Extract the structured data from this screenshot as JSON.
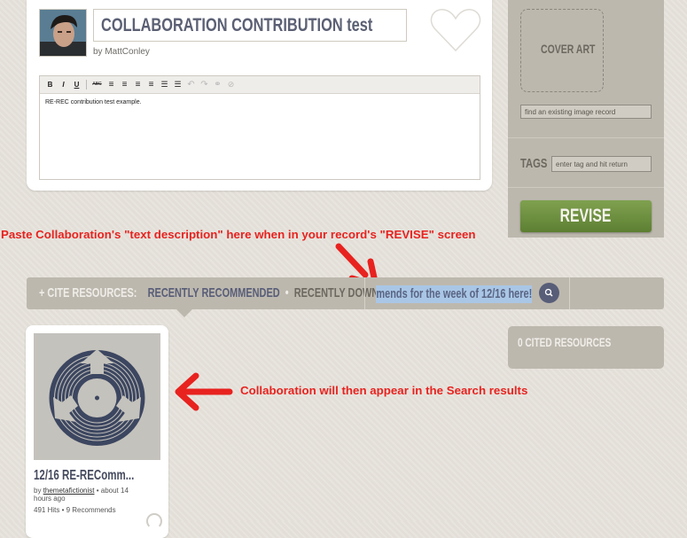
{
  "record": {
    "title": "COLLABORATION CONTRIBUTION test",
    "by_prefix": "by",
    "author": "MattConley",
    "editor_body": "RE-REC contribution test example."
  },
  "editor_toolbar": [
    {
      "label": "B",
      "icon": "bold-icon"
    },
    {
      "label": "I",
      "icon": "italic-icon"
    },
    {
      "label": "U",
      "icon": "underline-icon"
    },
    {
      "label": "ABC",
      "icon": "strikethrough-icon"
    },
    {
      "label": "≡",
      "icon": "align-left-icon"
    },
    {
      "label": "≡",
      "icon": "align-center-icon"
    },
    {
      "label": "≡",
      "icon": "align-right-icon"
    },
    {
      "label": "≡",
      "icon": "align-justify-icon"
    },
    {
      "label": "☰",
      "icon": "bullet-list-icon"
    },
    {
      "label": "☰",
      "icon": "numbered-list-icon"
    },
    {
      "label": "↶",
      "icon": "undo-icon"
    },
    {
      "label": "↷",
      "icon": "redo-icon"
    },
    {
      "label": "⚭",
      "icon": "link-icon"
    },
    {
      "label": "⊘",
      "icon": "unlink-icon"
    }
  ],
  "sidebar": {
    "cover_art_label": "COVER ART",
    "image_search_placeholder": "find an existing image record",
    "tags_label": "TAGS",
    "tags_placeholder": "enter tag and hit return",
    "revise_label": "REVISE"
  },
  "annotations": {
    "top": "Paste Collaboration's \"text description\" here when in your record's \"REVISE\" screen",
    "result": "Collaboration will then appear in the Search results"
  },
  "cite_bar": {
    "label": "+ CITE RESOURCES:",
    "recently_recommended": "RECENTLY RECOMMENDED",
    "separator": "•",
    "recently_downloaded": "RECENTLY DOWNLOADED",
    "search_value": "mmends for the week of 12/16 here!"
  },
  "cited_panel": {
    "label": "0 CITED RESOURCES"
  },
  "result": {
    "title": "12/16 RE-REComm...",
    "by_prefix": "by",
    "author": "themetafictionist",
    "time": " • about 14 hours ago",
    "stats": "491 Hits • 9 Recommends"
  },
  "colors": {
    "annotation_red": "#e8221f",
    "revise_green": "#6b8e3e",
    "slate_blue": "#585e78",
    "selection_blue": "#a9c6e6"
  }
}
